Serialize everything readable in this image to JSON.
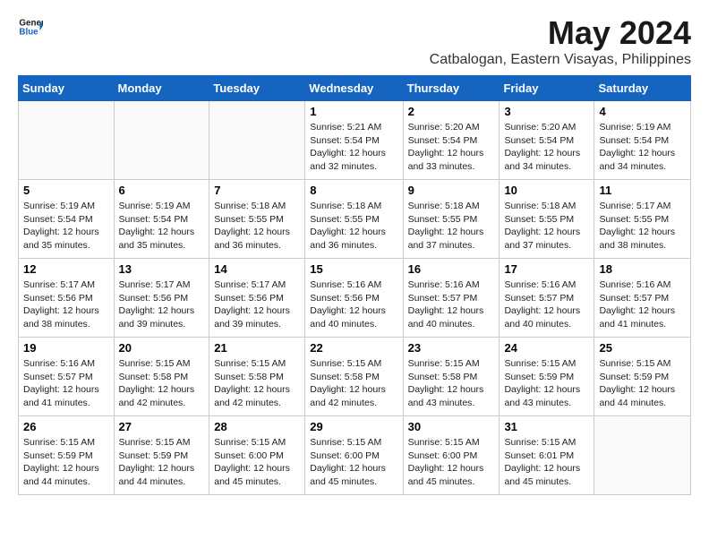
{
  "logo": {
    "line1": "General",
    "line2": "Blue"
  },
  "title": "May 2024",
  "location": "Catbalogan, Eastern Visayas, Philippines",
  "days_of_week": [
    "Sunday",
    "Monday",
    "Tuesday",
    "Wednesday",
    "Thursday",
    "Friday",
    "Saturday"
  ],
  "weeks": [
    [
      {
        "day": "",
        "info": ""
      },
      {
        "day": "",
        "info": ""
      },
      {
        "day": "",
        "info": ""
      },
      {
        "day": "1",
        "info": "Sunrise: 5:21 AM\nSunset: 5:54 PM\nDaylight: 12 hours\nand 32 minutes."
      },
      {
        "day": "2",
        "info": "Sunrise: 5:20 AM\nSunset: 5:54 PM\nDaylight: 12 hours\nand 33 minutes."
      },
      {
        "day": "3",
        "info": "Sunrise: 5:20 AM\nSunset: 5:54 PM\nDaylight: 12 hours\nand 34 minutes."
      },
      {
        "day": "4",
        "info": "Sunrise: 5:19 AM\nSunset: 5:54 PM\nDaylight: 12 hours\nand 34 minutes."
      }
    ],
    [
      {
        "day": "5",
        "info": "Sunrise: 5:19 AM\nSunset: 5:54 PM\nDaylight: 12 hours\nand 35 minutes."
      },
      {
        "day": "6",
        "info": "Sunrise: 5:19 AM\nSunset: 5:54 PM\nDaylight: 12 hours\nand 35 minutes."
      },
      {
        "day": "7",
        "info": "Sunrise: 5:18 AM\nSunset: 5:55 PM\nDaylight: 12 hours\nand 36 minutes."
      },
      {
        "day": "8",
        "info": "Sunrise: 5:18 AM\nSunset: 5:55 PM\nDaylight: 12 hours\nand 36 minutes."
      },
      {
        "day": "9",
        "info": "Sunrise: 5:18 AM\nSunset: 5:55 PM\nDaylight: 12 hours\nand 37 minutes."
      },
      {
        "day": "10",
        "info": "Sunrise: 5:18 AM\nSunset: 5:55 PM\nDaylight: 12 hours\nand 37 minutes."
      },
      {
        "day": "11",
        "info": "Sunrise: 5:17 AM\nSunset: 5:55 PM\nDaylight: 12 hours\nand 38 minutes."
      }
    ],
    [
      {
        "day": "12",
        "info": "Sunrise: 5:17 AM\nSunset: 5:56 PM\nDaylight: 12 hours\nand 38 minutes."
      },
      {
        "day": "13",
        "info": "Sunrise: 5:17 AM\nSunset: 5:56 PM\nDaylight: 12 hours\nand 39 minutes."
      },
      {
        "day": "14",
        "info": "Sunrise: 5:17 AM\nSunset: 5:56 PM\nDaylight: 12 hours\nand 39 minutes."
      },
      {
        "day": "15",
        "info": "Sunrise: 5:16 AM\nSunset: 5:56 PM\nDaylight: 12 hours\nand 40 minutes."
      },
      {
        "day": "16",
        "info": "Sunrise: 5:16 AM\nSunset: 5:57 PM\nDaylight: 12 hours\nand 40 minutes."
      },
      {
        "day": "17",
        "info": "Sunrise: 5:16 AM\nSunset: 5:57 PM\nDaylight: 12 hours\nand 40 minutes."
      },
      {
        "day": "18",
        "info": "Sunrise: 5:16 AM\nSunset: 5:57 PM\nDaylight: 12 hours\nand 41 minutes."
      }
    ],
    [
      {
        "day": "19",
        "info": "Sunrise: 5:16 AM\nSunset: 5:57 PM\nDaylight: 12 hours\nand 41 minutes."
      },
      {
        "day": "20",
        "info": "Sunrise: 5:15 AM\nSunset: 5:58 PM\nDaylight: 12 hours\nand 42 minutes."
      },
      {
        "day": "21",
        "info": "Sunrise: 5:15 AM\nSunset: 5:58 PM\nDaylight: 12 hours\nand 42 minutes."
      },
      {
        "day": "22",
        "info": "Sunrise: 5:15 AM\nSunset: 5:58 PM\nDaylight: 12 hours\nand 42 minutes."
      },
      {
        "day": "23",
        "info": "Sunrise: 5:15 AM\nSunset: 5:58 PM\nDaylight: 12 hours\nand 43 minutes."
      },
      {
        "day": "24",
        "info": "Sunrise: 5:15 AM\nSunset: 5:59 PM\nDaylight: 12 hours\nand 43 minutes."
      },
      {
        "day": "25",
        "info": "Sunrise: 5:15 AM\nSunset: 5:59 PM\nDaylight: 12 hours\nand 44 minutes."
      }
    ],
    [
      {
        "day": "26",
        "info": "Sunrise: 5:15 AM\nSunset: 5:59 PM\nDaylight: 12 hours\nand 44 minutes."
      },
      {
        "day": "27",
        "info": "Sunrise: 5:15 AM\nSunset: 5:59 PM\nDaylight: 12 hours\nand 44 minutes."
      },
      {
        "day": "28",
        "info": "Sunrise: 5:15 AM\nSunset: 6:00 PM\nDaylight: 12 hours\nand 45 minutes."
      },
      {
        "day": "29",
        "info": "Sunrise: 5:15 AM\nSunset: 6:00 PM\nDaylight: 12 hours\nand 45 minutes."
      },
      {
        "day": "30",
        "info": "Sunrise: 5:15 AM\nSunset: 6:00 PM\nDaylight: 12 hours\nand 45 minutes."
      },
      {
        "day": "31",
        "info": "Sunrise: 5:15 AM\nSunset: 6:01 PM\nDaylight: 12 hours\nand 45 minutes."
      },
      {
        "day": "",
        "info": ""
      }
    ]
  ]
}
